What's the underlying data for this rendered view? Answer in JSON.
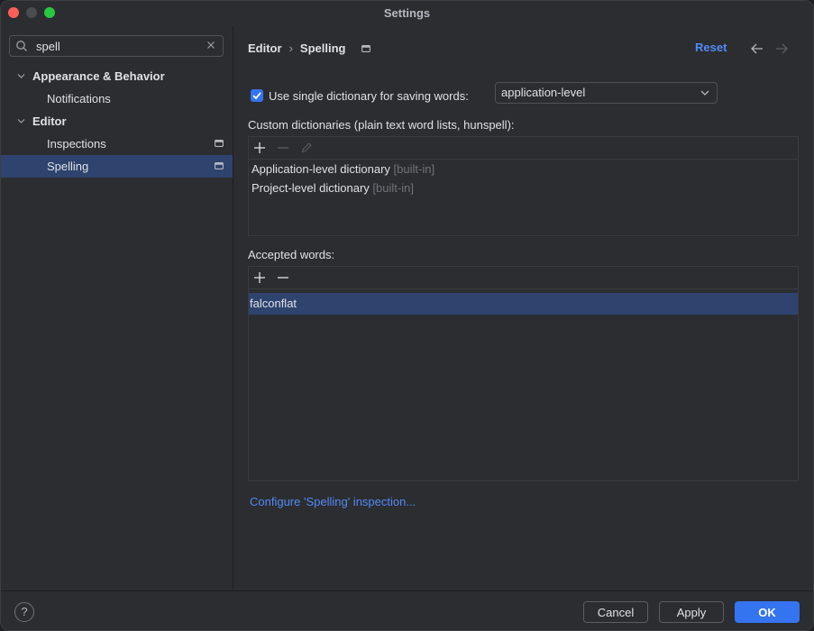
{
  "window": {
    "title": "Settings"
  },
  "search": {
    "value": "spell"
  },
  "tree": [
    {
      "label": "Appearance & Behavior",
      "level": 0,
      "expanded": true
    },
    {
      "label": "Notifications",
      "level": 1
    },
    {
      "label": "Editor",
      "level": 0,
      "expanded": true
    },
    {
      "label": "Inspections",
      "level": 1,
      "project_scope": true
    },
    {
      "label": "Spelling",
      "level": 1,
      "project_scope": true,
      "selected": true
    }
  ],
  "breadcrumb": {
    "parent": "Editor",
    "separator": "›",
    "current": "Spelling"
  },
  "header": {
    "reset_label": "Reset"
  },
  "single_dictionary": {
    "label": "Use single dictionary for saving words:",
    "checked": true,
    "selected": "application-level"
  },
  "custom_dictionaries": {
    "label": "Custom dictionaries (plain text word lists, hunspell):",
    "items": [
      {
        "name": "Application-level dictionary",
        "tag": "[built-in]"
      },
      {
        "name": "Project-level dictionary",
        "tag": "[built-in]"
      }
    ]
  },
  "accepted_words": {
    "label": "Accepted words:",
    "items": [
      "falconflat"
    ]
  },
  "configure_link": "Configure 'Spelling' inspection...",
  "footer": {
    "help": "?",
    "cancel": "Cancel",
    "apply": "Apply",
    "ok": "OK"
  },
  "colors": {
    "accent": "#3574f0",
    "link": "#548af7",
    "selection": "#2e436e"
  }
}
